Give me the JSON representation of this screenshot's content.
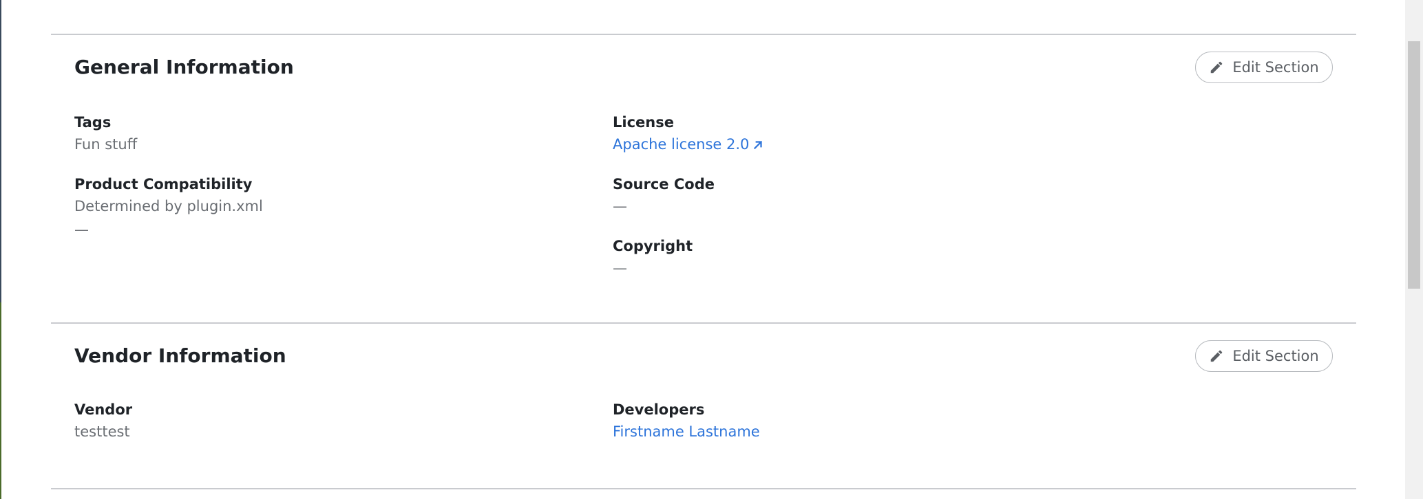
{
  "general": {
    "title": "General Information",
    "edit_label": "Edit Section",
    "tags": {
      "label": "Tags",
      "value": "Fun stuff"
    },
    "license": {
      "label": "License",
      "value": "Apache license 2.0"
    },
    "compatibility": {
      "label": "Product Compatibility",
      "value": "Determined by plugin.xml",
      "extra": "—"
    },
    "source_code": {
      "label": "Source Code",
      "value": "—"
    },
    "copyright": {
      "label": "Copyright",
      "value": "—"
    }
  },
  "vendor": {
    "title": "Vendor Information",
    "edit_label": "Edit Section",
    "vendor": {
      "label": "Vendor",
      "value": "testtest"
    },
    "developers": {
      "label": "Developers",
      "value": "Firstname Lastname"
    }
  },
  "colors": {
    "link": "#2d74da",
    "heading": "#1f2328",
    "muted": "#6a6e73",
    "divider": "#c9cbcf"
  },
  "icons": {
    "edit": "pencil-icon",
    "external": "arrow-up-right-icon"
  }
}
